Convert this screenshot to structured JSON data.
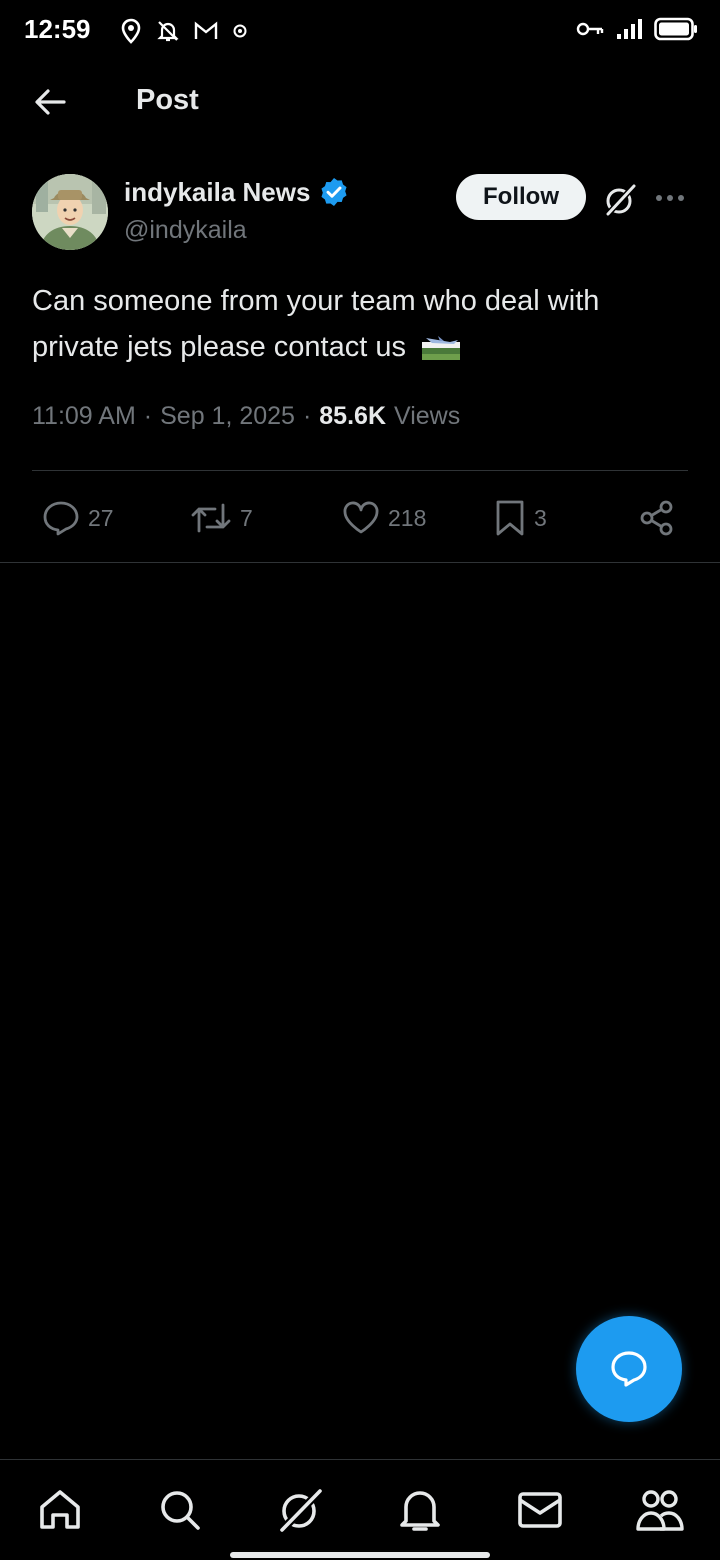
{
  "status_bar": {
    "time": "12:59",
    "left_icons": [
      "location-icon",
      "bell-off-icon",
      "gmail-icon",
      "settings-dot-icon"
    ],
    "right_icons": [
      "vpn-key-icon",
      "signal-icon",
      "battery-icon"
    ]
  },
  "header": {
    "title": "Post",
    "back_icon": "arrow-left-icon"
  },
  "post": {
    "author": {
      "name": "indykaila News",
      "handle": "@indykaila",
      "verified": true,
      "verified_color": "#1d9bf0"
    },
    "follow_label": "Follow",
    "text": "Can someone from your team who deal with private jets please contact us",
    "emoji": "airplane-arrival-flag-emoji",
    "time": "11:09 AM",
    "separator": "·",
    "date": "Sep 1, 2025",
    "views_count": "85.6K",
    "views_label": "Views",
    "stats": {
      "replies": "27",
      "reposts": "7",
      "likes": "218",
      "bookmarks": "3"
    }
  },
  "bottom_nav": [
    "home-icon",
    "search-icon",
    "grok-icon",
    "notifications-icon",
    "messages-icon",
    "communities-icon"
  ],
  "colors": {
    "background": "#000000",
    "accent": "#1d9bf0",
    "text_primary": "#e7e9ea",
    "text_secondary": "#71767b",
    "divider": "#2f3336"
  }
}
